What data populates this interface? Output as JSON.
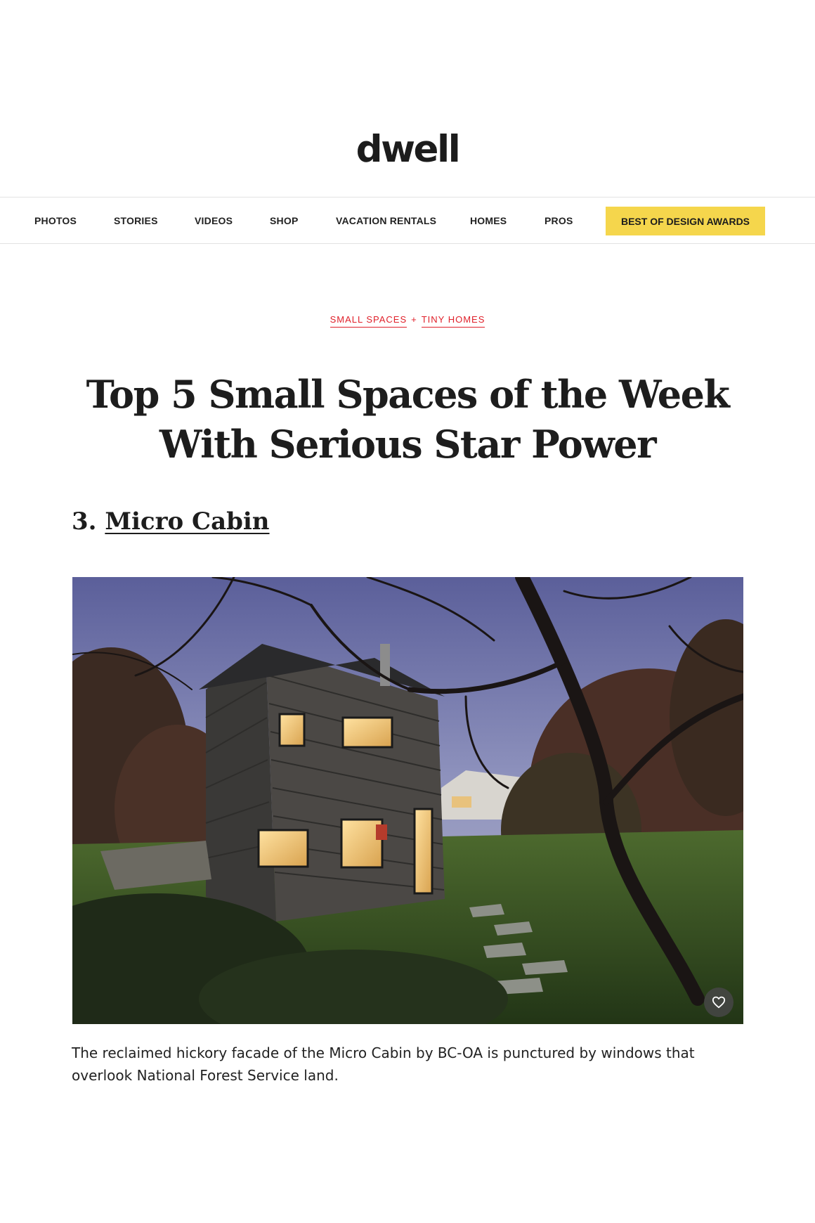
{
  "site": {
    "logo": "dwell"
  },
  "nav": {
    "items": [
      "PHOTOS",
      "STORIES",
      "VIDEOS",
      "SHOP",
      "VACATION RENTALS",
      "HOMES",
      "PROS"
    ],
    "cta": "BEST OF DESIGN AWARDS",
    "cta_color": "#f5d64c"
  },
  "article": {
    "category_1": "SMALL SPACES",
    "category_separator": "+",
    "category_2": "TINY HOMES",
    "category_color": "#e0202a",
    "title_line_1": "Top 5 Small Spaces of the Week",
    "title_line_2": "With Serious Star Power",
    "section_number": "3.",
    "section_title": "Micro Cabin",
    "caption": "The reclaimed hickory facade of the Micro Cabin by BC-OA is punctured by windows that overlook National Forest Service land."
  },
  "icons": {
    "favorite": "heart-icon"
  }
}
